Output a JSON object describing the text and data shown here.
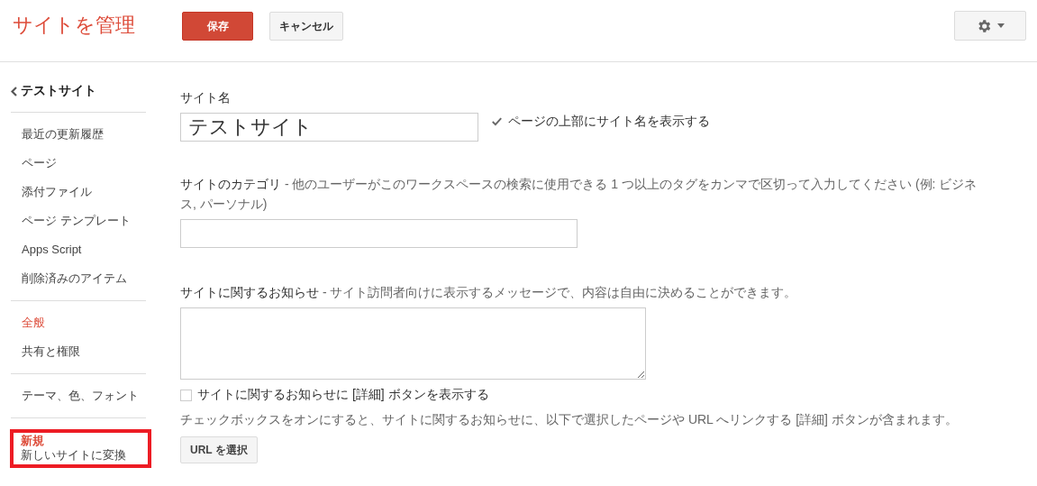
{
  "header": {
    "title": "サイトを管理",
    "save_button": "保存",
    "cancel_button": "キャンセル"
  },
  "sidebar": {
    "back_link": "テストサイト",
    "groups": [
      {
        "highlighted": false,
        "items": [
          {
            "label": "最近の更新履歴",
            "selected": false
          },
          {
            "label": "ページ",
            "selected": false
          },
          {
            "label": "添付ファイル",
            "selected": false
          },
          {
            "label": "ページ テンプレート",
            "selected": false
          },
          {
            "label": "Apps Script",
            "selected": false
          },
          {
            "label": "削除済みのアイテム",
            "selected": false
          }
        ]
      },
      {
        "highlighted": false,
        "items": [
          {
            "label": "全般",
            "selected": true
          },
          {
            "label": "共有と権限",
            "selected": false
          }
        ]
      },
      {
        "highlighted": false,
        "items": [
          {
            "label": "テーマ、色、フォント",
            "selected": false
          }
        ]
      },
      {
        "highlighted": true,
        "badge": "新規",
        "items": [
          {
            "label": "新しいサイトに変換",
            "selected": false
          }
        ]
      }
    ]
  },
  "form": {
    "site_name": {
      "label": "サイト名",
      "value": "テストサイト",
      "show_title_checkbox": {
        "label": "ページの上部にサイト名を表示する",
        "checked": true
      }
    },
    "category": {
      "label": "サイトのカテゴリ",
      "description": " - 他のユーザーがこのワークスペースの検索に使用できる 1 つ以上のタグをカンマで区切って入力してください (例: ビジネス, パーソナル)"
    },
    "announcement": {
      "label": "サイトに関するお知らせ",
      "description": " - サイト訪問者向けに表示するメッセージで、内容は自由に決めることができます。",
      "details_checkbox": {
        "label": "サイトに関するお知らせに [詳細] ボタンを表示する",
        "checked": false
      },
      "help": "チェックボックスをオンにすると、サイトに関するお知らせに、以下で選択したページや URL へリンクする [詳細] ボタンが含まれます。",
      "url_button": "URL を選択"
    }
  }
}
